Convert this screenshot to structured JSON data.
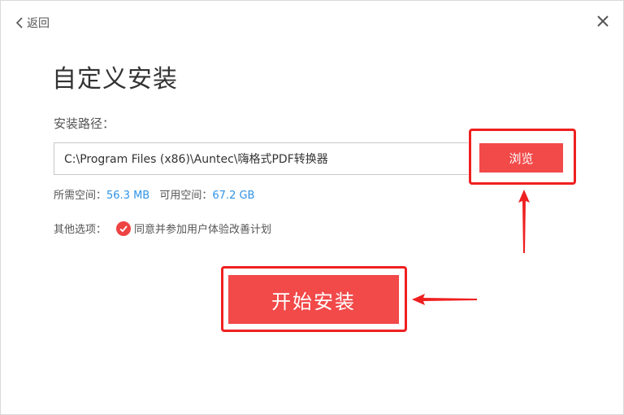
{
  "header": {
    "back_label": "返回",
    "back_icon": "chevron-left-icon",
    "close_icon": "close-icon"
  },
  "title": "自定义安装",
  "install_path": {
    "label": "安装路径：",
    "value": "C:\\Program Files (x86)\\Auntec\\嗨格式PDF转换器",
    "browse_label": "浏览"
  },
  "space": {
    "required_label": "所需空间：",
    "required_value": "56.3 MB",
    "available_label": "可用空间：",
    "available_value": "67.2 GB"
  },
  "options": {
    "label": "其他选项：",
    "checkbox_label": "同意并参加用户体验改善计划",
    "checked": true
  },
  "install_button": "开始安装",
  "colors": {
    "accent": "#f24949",
    "annotation": "#ef2020",
    "link_value": "#2f93e6"
  }
}
